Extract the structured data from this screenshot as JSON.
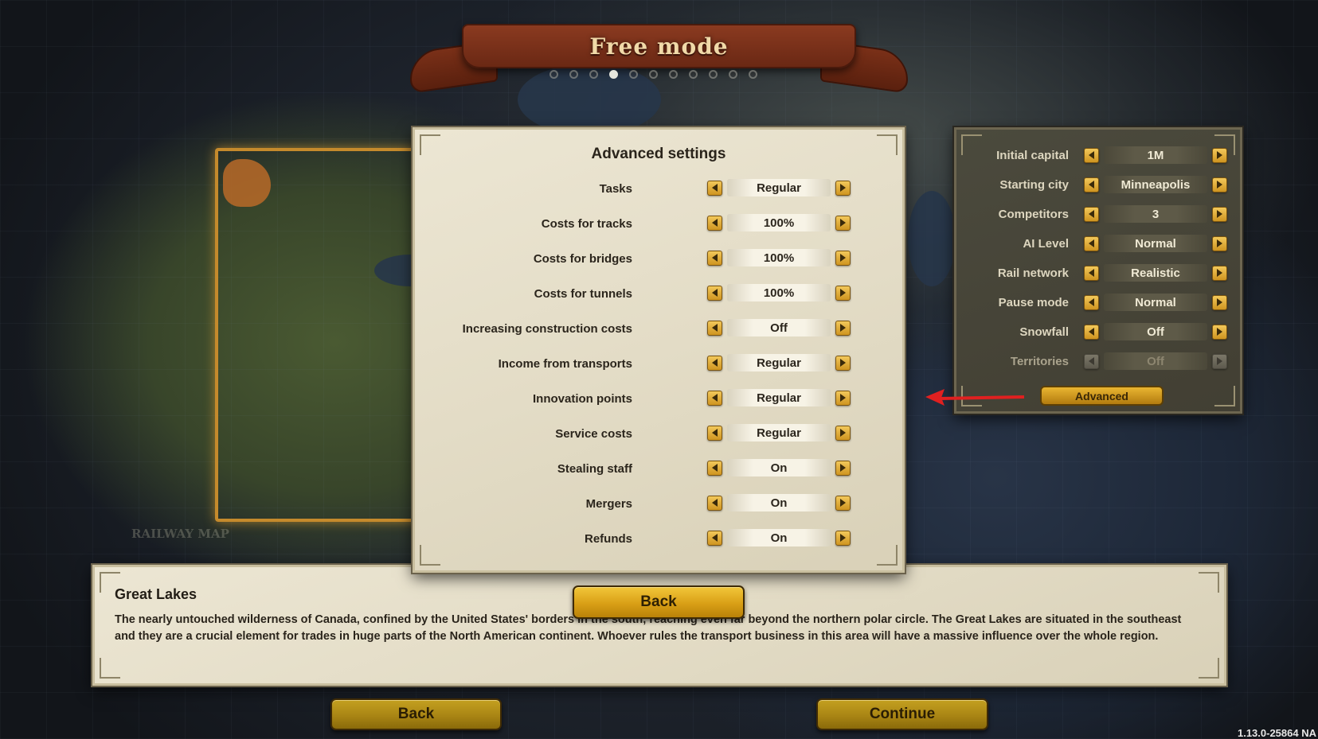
{
  "header": {
    "title": "Free mode",
    "page_dots": 11,
    "active_dot": 4
  },
  "map": {
    "region_label": "RAILWAY MAP"
  },
  "advanced_settings": {
    "title": "Advanced settings",
    "rows": [
      {
        "label": "Tasks",
        "value": "Regular"
      },
      {
        "label": "Costs for tracks",
        "value": "100%"
      },
      {
        "label": "Costs for bridges",
        "value": "100%"
      },
      {
        "label": "Costs for tunnels",
        "value": "100%"
      },
      {
        "label": "Increasing construction costs",
        "value": "Off"
      },
      {
        "label": "Income from transports",
        "value": "Regular"
      },
      {
        "label": "Innovation points",
        "value": "Regular"
      },
      {
        "label": "Service costs",
        "value": "Regular"
      },
      {
        "label": "Stealing staff",
        "value": "On"
      },
      {
        "label": "Mergers",
        "value": "On"
      },
      {
        "label": "Refunds",
        "value": "On"
      }
    ],
    "back_label": "Back"
  },
  "game_settings": {
    "rows": [
      {
        "label": "Initial capital",
        "value": "1M",
        "enabled": true
      },
      {
        "label": "Starting city",
        "value": "Minneapolis",
        "enabled": true
      },
      {
        "label": "Competitors",
        "value": "3",
        "enabled": true
      },
      {
        "label": "AI Level",
        "value": "Normal",
        "enabled": true
      },
      {
        "label": "Rail network",
        "value": "Realistic",
        "enabled": true
      },
      {
        "label": "Pause mode",
        "value": "Normal",
        "enabled": true
      },
      {
        "label": "Snowfall",
        "value": "Off",
        "enabled": true
      },
      {
        "label": "Territories",
        "value": "Off",
        "enabled": false
      }
    ],
    "advanced_label": "Advanced"
  },
  "description": {
    "title": "Great Lakes",
    "text": "The nearly untouched wilderness of Canada, confined by the United States' borders in the south, reaching even far beyond the northern polar circle. The Great Lakes are situated in the southeast and they are a crucial element for trades in huge parts of the North American continent. Whoever rules the transport business in this area will have a massive influence over the whole region."
  },
  "footer": {
    "back_label": "Back",
    "continue_label": "Continue",
    "version": "1.13.0-25864 NA"
  },
  "colors": {
    "accent_gold": "#d99f16",
    "banner_red": "#7a3018",
    "pointer_red": "#e02020"
  }
}
